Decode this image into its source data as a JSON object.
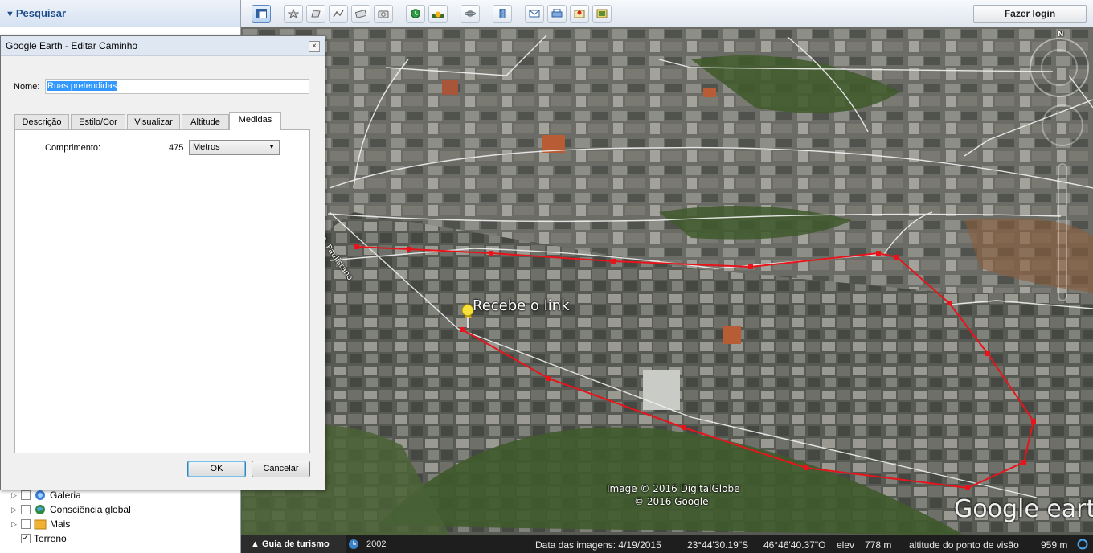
{
  "sidebar": {
    "search_title": "Pesquisar",
    "layers": [
      {
        "label": "Galeria",
        "checked": false
      },
      {
        "label": "Consciência global",
        "checked": false
      },
      {
        "label": "Mais",
        "checked": false
      },
      {
        "label": "Terreno",
        "checked": true
      }
    ]
  },
  "toolbar": {
    "login_label": "Fazer login"
  },
  "dialog": {
    "title": "Google Earth - Editar Caminho",
    "close_glyph": "×",
    "name_label": "Nome:",
    "name_value": "Ruas pretendidas",
    "tabs": [
      "Descrição",
      "Estilo/Cor",
      "Visualizar",
      "Altitude",
      "Medidas"
    ],
    "active_tab": "Medidas",
    "length_label": "Comprimento:",
    "length_value": "475",
    "unit_selected": "Metros",
    "ok_label": "OK",
    "cancel_label": "Cancelar"
  },
  "map": {
    "placemark_label": "Recebe o link",
    "street_label": "R. Paulistano",
    "compass_north": "N",
    "attribution_1": "Image © 2016 DigitalGlobe",
    "attribution_2": "© 2016 Google",
    "logo": "Google earth",
    "path_color": "#e8141b"
  },
  "status": {
    "tour_label": "Guia de turismo",
    "year": "2002",
    "image_date": "Data das imagens: 4/19/2015",
    "lat": "23°44'30.19\"S",
    "lon": "46°46'40.37\"O",
    "elev_label": "elev",
    "elev_value": "778 m",
    "eye_label": "altitude do ponto de visão",
    "eye_value": "959 m"
  }
}
